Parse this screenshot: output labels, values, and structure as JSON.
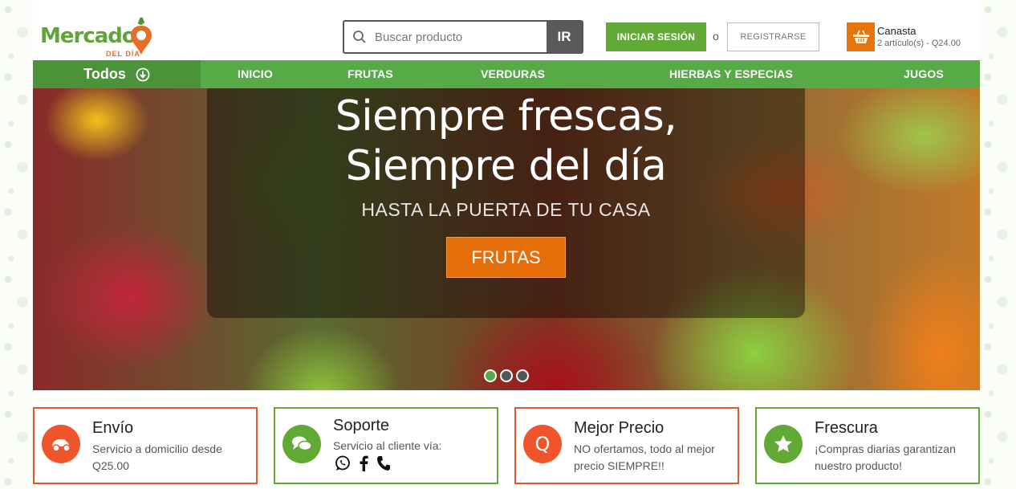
{
  "brand": {
    "name": "Mercado",
    "tagline": "DEL DÍA"
  },
  "search": {
    "placeholder": "Buscar producto",
    "button_label": "IR"
  },
  "account": {
    "login_label": "INICIAR SESIÓN",
    "or_text": "o",
    "register_label": "REGISTRARSE"
  },
  "cart": {
    "title": "Canasta",
    "summary": "2 artículo(s) - Q24.00"
  },
  "nav": {
    "todos_label": "Todos",
    "items": [
      {
        "label": "INICIO"
      },
      {
        "label": "FRUTAS"
      },
      {
        "label": "VERDURAS"
      },
      {
        "label": "HIERBAS Y ESPECIAS"
      },
      {
        "label": "JUGOS"
      }
    ]
  },
  "hero": {
    "title_line1": "Siempre frescas,",
    "title_line2": "Siempre del día",
    "subtitle": "HASTA LA PUERTA DE TU CASA",
    "cta_label": "FRUTAS",
    "slide_count": 3,
    "active_slide": 1
  },
  "features": [
    {
      "title": "Envío",
      "description": "Servicio a domicilio desde Q25.00",
      "icon": "delivery-icon"
    },
    {
      "title": "Soporte",
      "description": "Servicio al cliente vía:",
      "icon": "chat-icon",
      "channels": [
        "whatsapp-icon",
        "facebook-icon",
        "phone-icon"
      ]
    },
    {
      "title": "Mejor Precio",
      "description": "NO ofertamos, todo al mejor precio SIEMPRE!!",
      "icon": "price-q-icon",
      "icon_letter": "Q"
    },
    {
      "title": "Frescura",
      "description": "¡Compras diarias garantizan nuestro producto!",
      "icon": "star-icon"
    }
  ],
  "colors": {
    "brand_green": "#57ab46",
    "accent_orange": "#e56e0b",
    "feature_orange": "#e2562e"
  }
}
